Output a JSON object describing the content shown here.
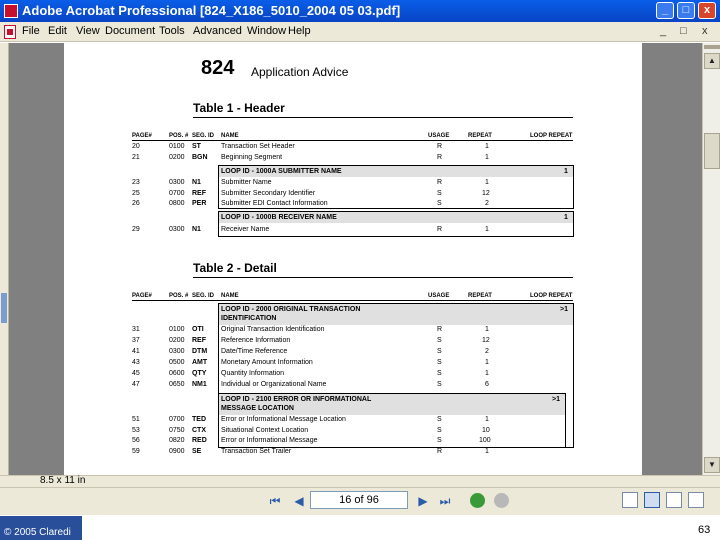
{
  "window": {
    "title": "Adobe Acrobat Professional   [824_X186_5010_2004 05 03.pdf]",
    "controls": [
      "_",
      "□",
      "x"
    ]
  },
  "menu": {
    "items": [
      "File",
      "Edit",
      "View",
      "Document",
      "Tools",
      "Advanced",
      "Window",
      "Help"
    ],
    "doc_controls": [
      "_",
      "□",
      "x"
    ]
  },
  "document": {
    "code": "824",
    "subtitle": "Application Advice",
    "table1": {
      "title": "Table 1 - Header",
      "headers": [
        "PAGE#",
        "POS. #",
        "SEG. ID",
        "NAME",
        "USAGE",
        "REPEAT",
        "LOOP REPEAT"
      ],
      "rows": [
        {
          "page": "20",
          "pos": "0100",
          "seg": "ST",
          "name": "Transaction Set Header",
          "usage": "R",
          "repeat": "1"
        },
        {
          "page": "21",
          "pos": "0200",
          "seg": "BGN",
          "name": "Beginning Segment",
          "usage": "R",
          "repeat": "1"
        }
      ],
      "loop1": {
        "label": "LOOP ID - 1000A  SUBMITTER NAME",
        "repeat": "1"
      },
      "loop1_rows": [
        {
          "page": "23",
          "pos": "0300",
          "seg": "N1",
          "name": "Submitter Name",
          "usage": "R",
          "repeat": "1"
        },
        {
          "page": "25",
          "pos": "0700",
          "seg": "REF",
          "name": "Submitter Secondary Identifier",
          "usage": "S",
          "repeat": "12"
        },
        {
          "page": "26",
          "pos": "0800",
          "seg": "PER",
          "name": "Submitter EDI Contact Information",
          "usage": "S",
          "repeat": "2"
        }
      ],
      "loop2": {
        "label": "LOOP ID - 1000B  RECEIVER NAME",
        "repeat": "1"
      },
      "loop2_rows": [
        {
          "page": "29",
          "pos": "0300",
          "seg": "N1",
          "name": "Receiver Name",
          "usage": "R",
          "repeat": "1"
        }
      ]
    },
    "table2": {
      "title": "Table 2 - Detail",
      "headers": [
        "PAGE#",
        "POS. #",
        "SEG. ID",
        "NAME",
        "USAGE",
        "REPEAT",
        "LOOP REPEAT"
      ],
      "loop1": {
        "label_line1": "LOOP ID - 2000  ORIGINAL TRANSACTION",
        "label_line2": "IDENTIFICATION",
        "repeat": ">1"
      },
      "loop1_rows": [
        {
          "page": "31",
          "pos": "0100",
          "seg": "OTI",
          "name": "Original Transaction Identification",
          "usage": "R",
          "repeat": "1"
        },
        {
          "page": "37",
          "pos": "0200",
          "seg": "REF",
          "name": "Reference Information",
          "usage": "S",
          "repeat": "12"
        },
        {
          "page": "41",
          "pos": "0300",
          "seg": "DTM",
          "name": "Date/Time Reference",
          "usage": "S",
          "repeat": "2"
        },
        {
          "page": "43",
          "pos": "0500",
          "seg": "AMT",
          "name": "Monetary Amount Information",
          "usage": "S",
          "repeat": "1"
        },
        {
          "page": "45",
          "pos": "0600",
          "seg": "QTY",
          "name": "Quantity Information",
          "usage": "S",
          "repeat": "1"
        },
        {
          "page": "47",
          "pos": "0650",
          "seg": "NM1",
          "name": "Individual or Organizational Name",
          "usage": "S",
          "repeat": "6"
        }
      ],
      "loop2": {
        "label_line1": "LOOP ID - 2100  ERROR OR INFORMATIONAL",
        "label_line2": "MESSAGE LOCATION",
        "repeat": ">1"
      },
      "loop2_rows": [
        {
          "page": "51",
          "pos": "0700",
          "seg": "TED",
          "name": "Error or Informational Message Location",
          "usage": "S",
          "repeat": "1"
        },
        {
          "page": "53",
          "pos": "0750",
          "seg": "CTX",
          "name": "Situational Context Location",
          "usage": "S",
          "repeat": "10"
        },
        {
          "page": "56",
          "pos": "0820",
          "seg": "RED",
          "name": "Error or Informational Message",
          "usage": "S",
          "repeat": "100"
        }
      ],
      "trailer": {
        "page": "59",
        "pos": "0900",
        "seg": "SE",
        "name": "Transaction Set Trailer",
        "usage": "R",
        "repeat": "1"
      }
    }
  },
  "status": {
    "page_size": "8.5 x 11 in"
  },
  "nav": {
    "page_field": "16 of 96"
  },
  "footer": {
    "brand": "© 2005 Claredi",
    "slide_number": "63"
  },
  "colors": {
    "titlebar": "#0a5ee8",
    "chrome": "#ece9d8",
    "doc_bg": "#808080",
    "footer_brand": "#2a4f9a"
  }
}
